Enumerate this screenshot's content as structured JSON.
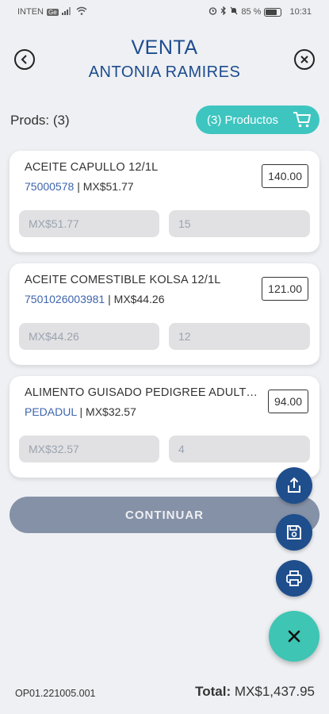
{
  "status_bar": {
    "carrier": "INTEN",
    "carrier_badge": "Ge",
    "battery_percent": "85 %",
    "time": "10:31"
  },
  "header": {
    "title": "VENTA",
    "subtitle": "ANTONIA RAMIRES",
    "back_icon": "chevron-left-icon",
    "close_icon": "close-icon"
  },
  "summary": {
    "prods_label": "Prods: (3)",
    "products_button": "(3) Productos",
    "cart_icon": "cart-icon"
  },
  "products": [
    {
      "name": "ACEITE CAPULLO 12/1L",
      "code": "75000578",
      "unit_price": "MX$51.77",
      "total": "140.00",
      "price_field": "MX$51.77",
      "qty_field": "15"
    },
    {
      "name": "ACEITE COMESTIBLE KOLSA 12/1L",
      "code": "7501026003981",
      "unit_price": "MX$44.26",
      "total": "121.00",
      "price_field": "MX$44.26",
      "qty_field": "12"
    },
    {
      "name": "ALIMENTO GUISADO PEDIGREE ADULTO...",
      "code": "PEDADUL",
      "unit_price": "MX$32.57",
      "total": "94.00",
      "price_field": "MX$32.57",
      "qty_field": "4"
    }
  ],
  "separator": "|",
  "actions": {
    "continue_label": "CONTINUAR",
    "share_icon": "share-icon",
    "save_icon": "save-icon",
    "print_icon": "print-icon",
    "close_fab_icon": "close-icon"
  },
  "footer": {
    "code": "OP01.221005.001",
    "total_label": "Total:",
    "total_value": "MX$1,437.95"
  },
  "colors": {
    "brand_blue": "#1d4b8f",
    "teal": "#3ec5c0",
    "code_blue": "#3e64ad",
    "continue_gray": "#8591a6"
  }
}
